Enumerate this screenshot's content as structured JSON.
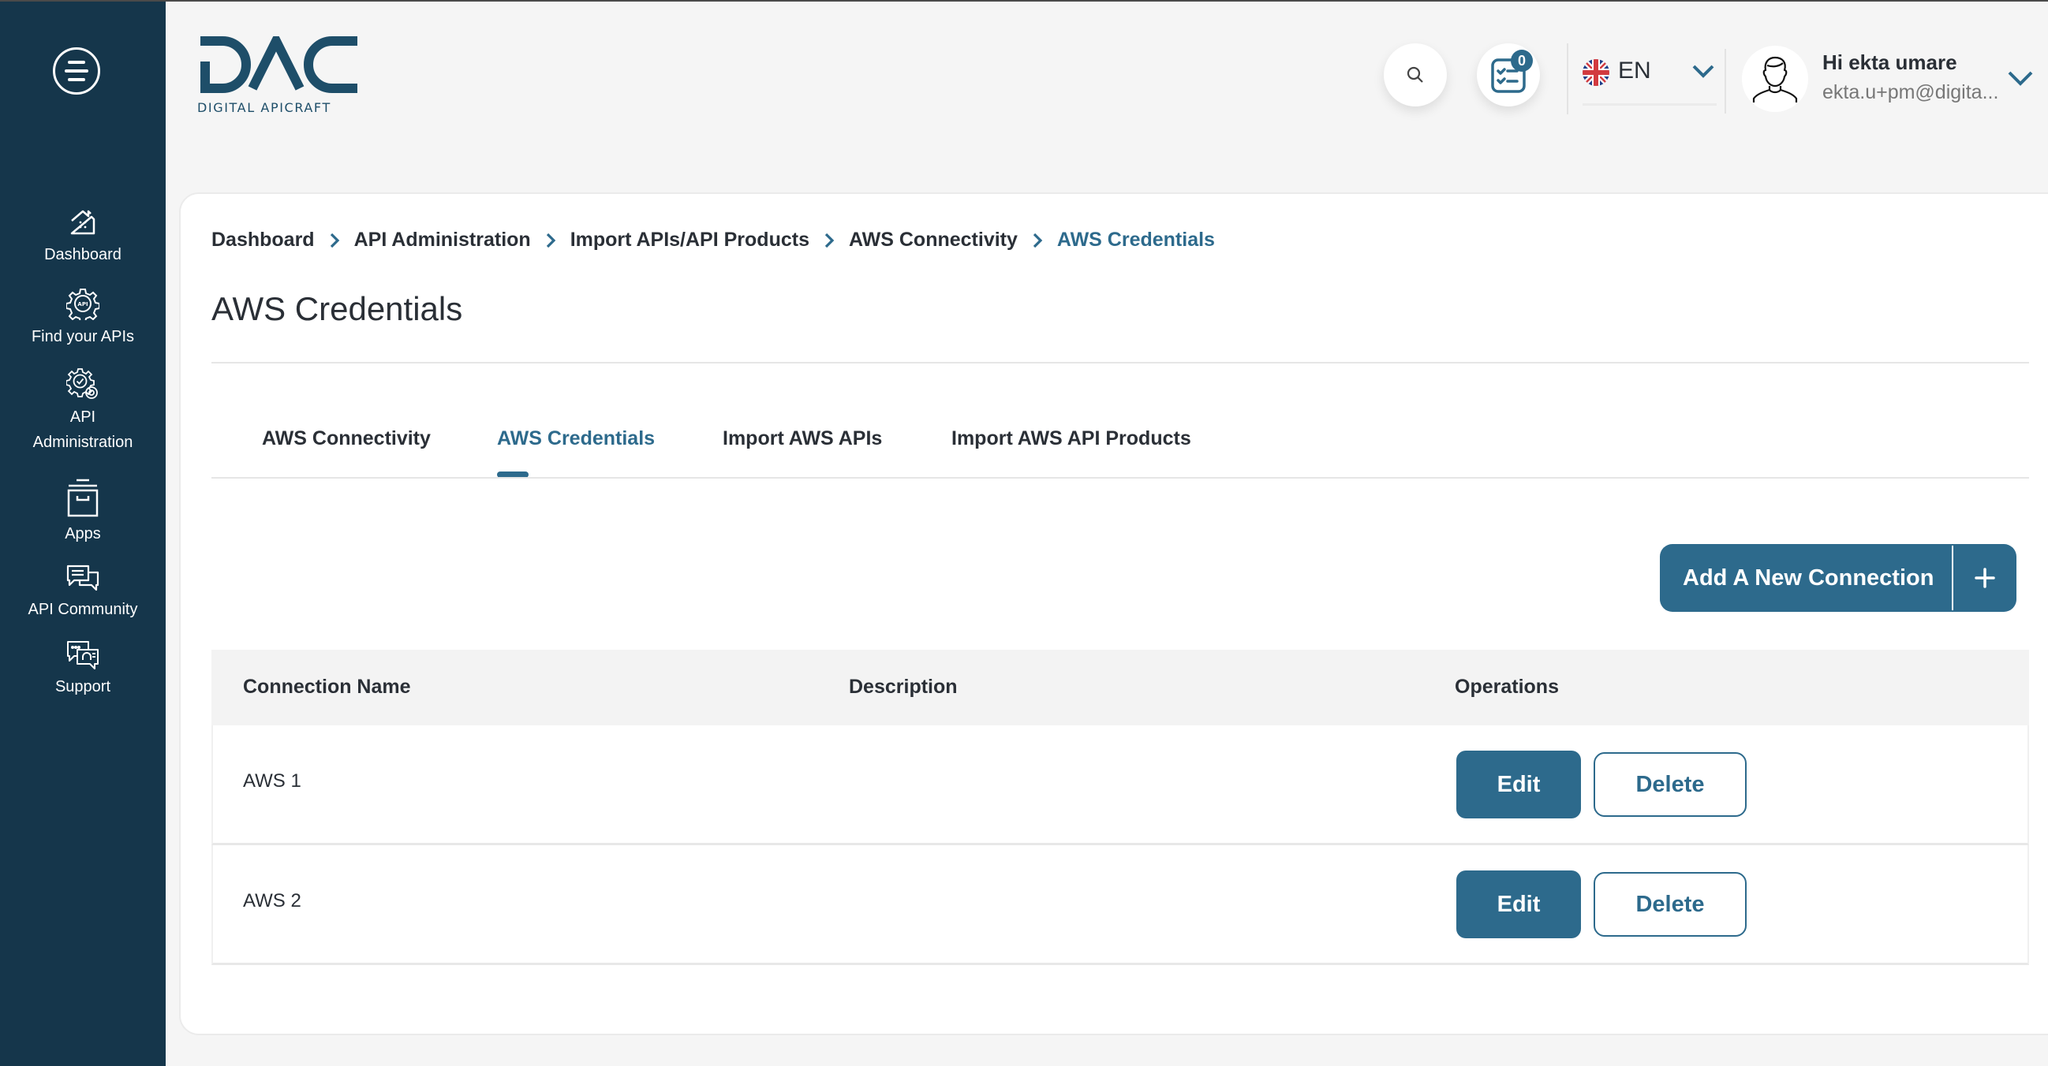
{
  "sidebar": {
    "items": [
      {
        "label": "Dashboard",
        "icon": "home-icon"
      },
      {
        "label": "Find your APIs",
        "icon": "api-gear-icon"
      },
      {
        "label_line1": "API",
        "label_line2": "Administration",
        "icon": "gears-admin-icon"
      },
      {
        "label": "Apps",
        "icon": "archive-box-icon"
      },
      {
        "label": "API Community",
        "icon": "chat-bubbles-icon"
      },
      {
        "label": "Support",
        "icon": "support-chat-icon"
      }
    ]
  },
  "header": {
    "logo_text": "DAC",
    "logo_subtext": "DIGITAL APICRAFT",
    "tasks_badge": "0",
    "language": "EN",
    "user_greeting": "Hi ekta umare",
    "user_email": "ekta.u+pm@digita..."
  },
  "breadcrumb": [
    {
      "label": "Dashboard"
    },
    {
      "label": "API Administration"
    },
    {
      "label": "Import APIs/API Products"
    },
    {
      "label": "AWS Connectivity"
    },
    {
      "label": "AWS Credentials"
    }
  ],
  "page": {
    "title": "AWS Credentials"
  },
  "tabs": [
    {
      "label": "AWS Connectivity",
      "active": false
    },
    {
      "label": "AWS Credentials",
      "active": true
    },
    {
      "label": "Import AWS APIs",
      "active": false
    },
    {
      "label": "Import AWS API Products",
      "active": false
    }
  ],
  "actions": {
    "add_connection_label": "Add A New Connection"
  },
  "table": {
    "columns": [
      "Connection Name",
      "Description",
      "Operations"
    ],
    "rows": [
      {
        "connection_name": "AWS 1",
        "description": "",
        "edit_label": "Edit",
        "delete_label": "Delete"
      },
      {
        "connection_name": "AWS 2",
        "description": "",
        "edit_label": "Edit",
        "delete_label": "Delete"
      }
    ]
  },
  "colors": {
    "sidebar_bg": "#15364b",
    "accent": "#2d6a8c",
    "page_bg": "#f5f5f5",
    "text": "#2a2f36"
  }
}
